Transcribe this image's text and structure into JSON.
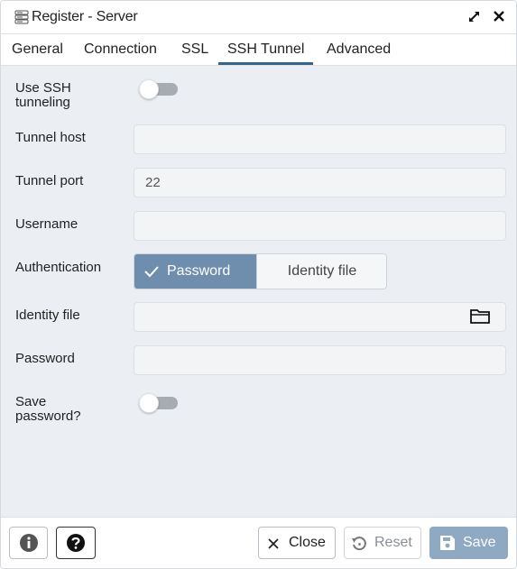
{
  "window": {
    "title": "Register - Server",
    "title_icon": "server-icon",
    "expand_icon": "expand-icon",
    "close_icon": "close-icon"
  },
  "tabs": [
    {
      "label": "General",
      "active": false
    },
    {
      "label": "Connection",
      "active": false
    },
    {
      "label": "SSL",
      "active": false
    },
    {
      "label": "SSH Tunnel",
      "active": true
    },
    {
      "label": "Advanced",
      "active": false
    }
  ],
  "form": {
    "use_ssh": {
      "label_line1": "Use SSH",
      "label_line2": "tunneling",
      "enabled": false
    },
    "tunnel_host": {
      "label": "Tunnel host",
      "value": ""
    },
    "tunnel_port": {
      "label": "Tunnel port",
      "value": "22"
    },
    "username": {
      "label": "Username",
      "value": ""
    },
    "authentication": {
      "label": "Authentication",
      "options": [
        "Password",
        "Identity file"
      ],
      "selected": "Password"
    },
    "identity_file": {
      "label": "Identity file",
      "value": "",
      "icon": "folder-icon"
    },
    "password": {
      "label": "Password",
      "value": ""
    },
    "save_password": {
      "label_line1": "Save",
      "label_line2": "password?",
      "enabled": false
    }
  },
  "footer": {
    "info_icon": "info-icon",
    "help_icon": "help-icon",
    "close_label": "Close",
    "reset_label": "Reset",
    "save_label": "Save"
  },
  "colors": {
    "accent": "#326690",
    "segment_selected": "#6f8dad",
    "save_button": "#8fa9c2",
    "content_background": "#ebeef3"
  }
}
